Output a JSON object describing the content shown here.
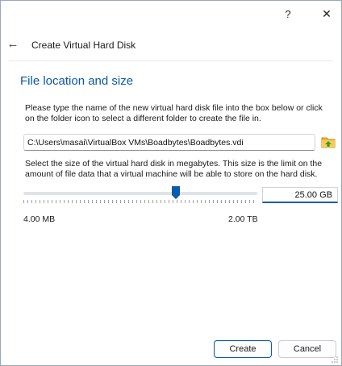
{
  "title_bar": {
    "help_label": "?",
    "close_label": "✕"
  },
  "header": {
    "back_label": "←",
    "title": "Create Virtual Hard Disk"
  },
  "section": {
    "title": "File location and size",
    "description_location": "Please type the name of the new virtual hard disk file into the box below or click on the folder icon to select a different folder to create the file in.",
    "file_path": "C:\\Users\\masai\\VirtualBox VMs\\Boadbytes\\Boadbytes.vdi",
    "folder_icon": "folder-icon",
    "description_size": "Select the size of the virtual hard disk in megabytes. This size is the limit on the amount of file data that a virtual machine will be able to store on the hard disk.",
    "size_value": "25.00 GB",
    "slider_min": "4.00 MB",
    "slider_max": "2.00 TB",
    "slider_level_percent": 65
  },
  "buttons": {
    "create": "Create",
    "cancel": "Cancel"
  },
  "colors": {
    "accent": "#0b5cad",
    "heading": "#0b57a4"
  }
}
